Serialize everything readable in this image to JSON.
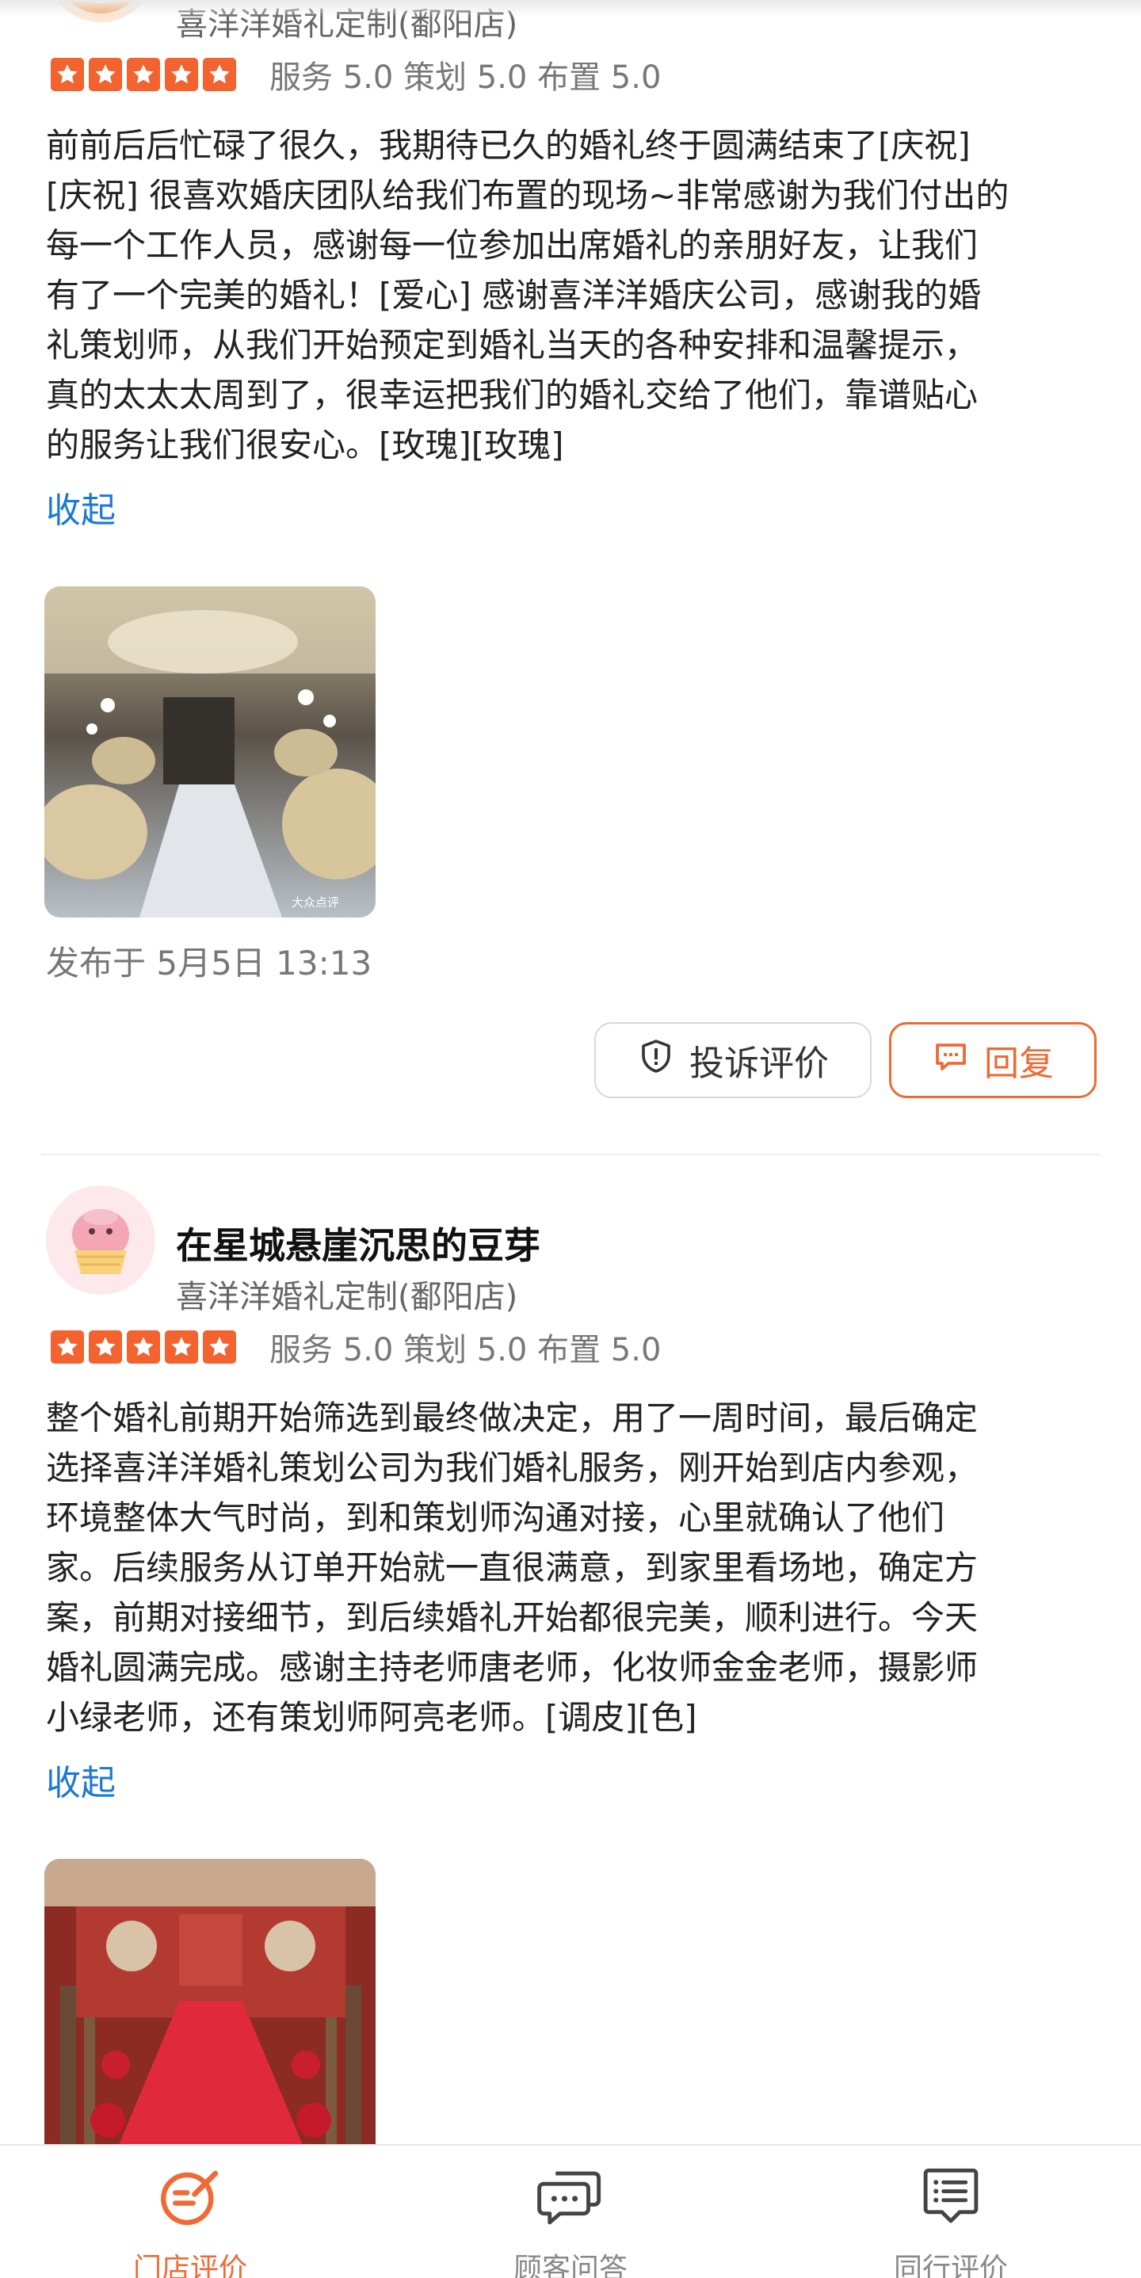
{
  "colors": {
    "accent": "#ee6a33",
    "link": "#1a78d6",
    "star": "#f2632f"
  },
  "reviews": [
    {
      "username": "",
      "shop": "喜洋洋婚礼定制(鄱阳店)",
      "stars": 5,
      "scores": "服务 5.0 策划 5.0 布置 5.0",
      "text_lines": [
        "前前后后忙碌了很久，我期待已久的婚礼终于圆满结束了[庆祝]",
        "[庆祝] 很喜欢婚庆团队给我们布置的现场~非常感谢为我们付出的",
        "每一个工作人员，感谢每一位参加出席婚礼的亲朋好友，让我们",
        "有了一个完美的婚礼！[爱心] 感谢喜洋洋婚庆公司，感谢我的婚",
        "礼策划师，从我们开始预定到婚礼当天的各种安排和温馨提示，",
        "真的太太太周到了，很幸运把我们的婚礼交给了他们，靠谱贴心",
        "的服务让我们很安心。[玫瑰][玫瑰]"
      ],
      "collapse_label": "收起",
      "photo_watermark": "大众点评",
      "publish_time": "发布于 5月5日 13:13",
      "complain_label": "投诉评价",
      "reply_label": "回复"
    },
    {
      "username": "在星城悬崖沉思的豆芽",
      "shop": "喜洋洋婚礼定制(鄱阳店)",
      "stars": 5,
      "scores": "服务 5.0 策划 5.0 布置 5.0",
      "text_lines": [
        "整个婚礼前期开始筛选到最终做决定，用了一周时间，最后确定",
        "选择喜洋洋婚礼策划公司为我们婚礼服务，刚开始到店内参观，",
        "环境整体大气时尚，到和策划师沟通对接，心里就确认了他们",
        "家。后续服务从订单开始就一直很满意，到家里看场地，确定方",
        "案，前期对接细节，到后续婚礼开始都很完美，顺利进行。今天",
        "婚礼圆满完成。感谢主持老师唐老师，化妆师金金老师，摄影师",
        "小绿老师，还有策划师阿亮老师。[调皮][色]"
      ],
      "collapse_label": "收起"
    }
  ],
  "tabbar": {
    "tabs": [
      {
        "label": "门店评价",
        "icon": "store-review-icon",
        "active": true
      },
      {
        "label": "顾客问答",
        "icon": "customer-qa-icon",
        "active": false
      },
      {
        "label": "同行评价",
        "icon": "peer-review-icon",
        "active": false
      }
    ]
  }
}
